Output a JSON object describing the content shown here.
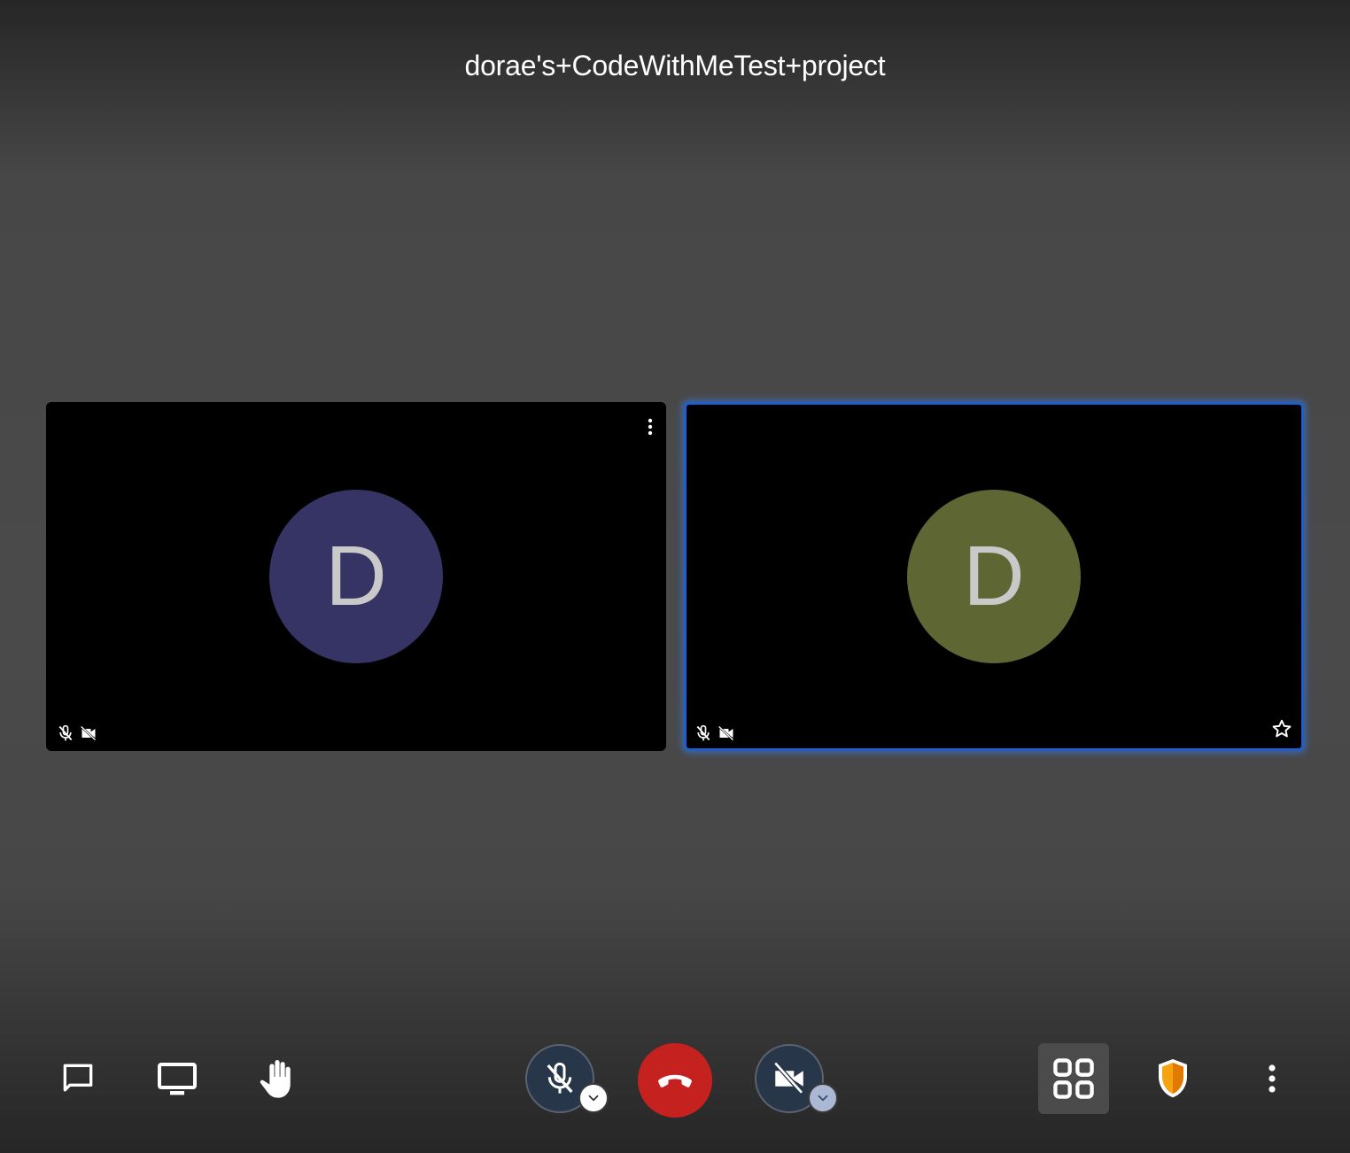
{
  "meeting": {
    "title": "dorae's+CodeWithMeTest+project"
  },
  "participants": [
    {
      "initial": "D",
      "avatar_color": "#353465",
      "audio_muted": true,
      "video_muted": true,
      "active_speaker": false,
      "has_menu": true
    },
    {
      "initial": "D",
      "avatar_color": "#5e6734",
      "audio_muted": true,
      "video_muted": true,
      "active_speaker": true,
      "has_star": true
    }
  ],
  "toolbar": {
    "left": [
      "chat-icon",
      "screen-share-icon",
      "raise-hand-icon"
    ],
    "center": [
      "microphone-muted-icon",
      "hangup-icon",
      "camera-muted-icon"
    ],
    "right": [
      "tile-view-icon",
      "security-shield-icon",
      "more-options-icon"
    ]
  },
  "colors": {
    "active_border": "#1f5fc9",
    "hangup": "#c5221f",
    "toggle_bg": "#273649",
    "shield": "#f5a40f"
  }
}
